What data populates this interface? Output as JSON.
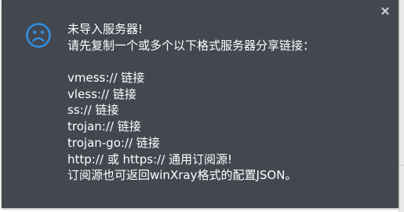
{
  "message": {
    "title": "未导入服务器!",
    "instruction": "请先复制一个或多个以下格式服务器分享链接：",
    "formats": [
      "vmess:// 链接",
      "vless:// 链接",
      "ss:// 链接",
      "trojan:// 链接",
      "trojan-go:// 链接"
    ],
    "subscription": "http:// 或 https:// 通用订阅源!",
    "note": "订阅源也可返回winXray格式的配置JSON。"
  },
  "icons": {
    "status": "sad-face-icon",
    "close": "close-icon"
  },
  "colors": {
    "toast_background": "#43474f",
    "text": "#ffffff",
    "icon_accent": "#2f8fe0"
  }
}
